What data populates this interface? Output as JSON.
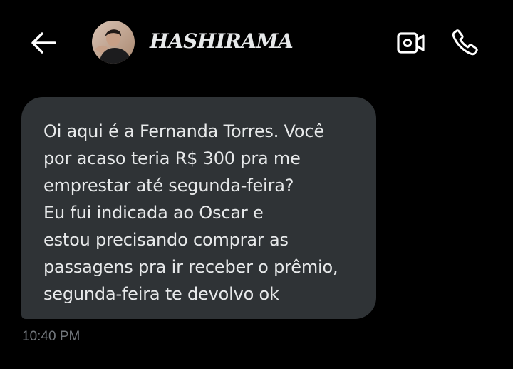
{
  "header": {
    "back_icon": "arrow-left-icon",
    "contact_name": "HASHIRAMA",
    "video_icon": "video-camera-icon",
    "call_icon": "phone-icon"
  },
  "message": {
    "text": "Oi aqui é a Fernanda Torres. Você\npor acaso teria R$ 300 pra me\nemprestar até segunda-feira?\nEu fui indicada ao Oscar e\nestou precisando comprar as\npassagens pra ir receber o prêmio,\nsegunda-feira te devolvo ok",
    "timestamp": "10:40 PM"
  },
  "colors": {
    "background": "#000000",
    "bubble": "#2f3336",
    "text": "#e7e9ea",
    "muted": "#71767b"
  }
}
